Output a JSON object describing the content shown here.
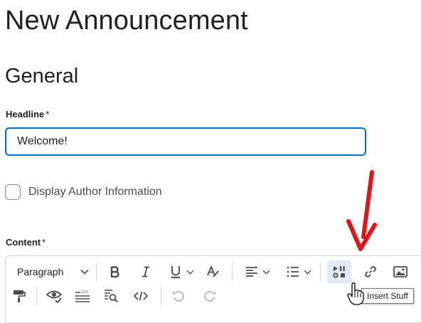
{
  "page": {
    "title": "New Announcement"
  },
  "section": {
    "title": "General"
  },
  "headline": {
    "label": "Headline",
    "required_mark": "*",
    "value": "Welcome!"
  },
  "author_info": {
    "label": "Display Author Information",
    "checked": false
  },
  "content": {
    "label": "Content",
    "required_mark": "*",
    "toolbar": {
      "format_select": "Paragraph",
      "row1": [
        "bold-icon",
        "italic-icon",
        "underline-icon",
        "strikethrough-format-icon",
        "align-left-icon",
        "bullet-list-icon",
        "insert-stuff-icon",
        "link-icon",
        "image-icon"
      ],
      "row2": [
        "format-painter-icon",
        "preview-icon",
        "word-count-icon",
        "find-replace-icon",
        "source-code-icon",
        "undo-icon",
        "redo-icon"
      ],
      "tooltip": "Insert Stuff"
    }
  },
  "annotation": {
    "arrow_color": "#e0141a"
  },
  "colors": {
    "focus_border": "#006fbf",
    "text": "#202122",
    "icon": "#494c4e"
  }
}
